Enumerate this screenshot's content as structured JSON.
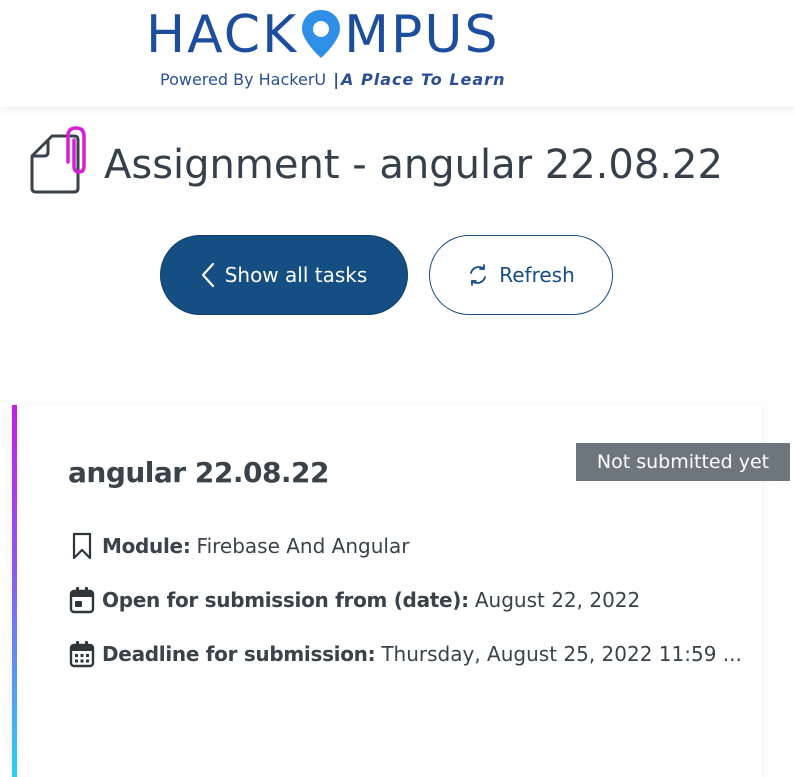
{
  "header": {
    "logo_left": "HACK",
    "logo_right": "MPUS",
    "tagline_left": "Powered By HackerU",
    "tagline_sep": "|",
    "tagline_right": "A Place To Learn",
    "brand_color": "#1d4e9e"
  },
  "page": {
    "title": "Assignment - angular 22.08.22",
    "icon": "document-paperclip-icon"
  },
  "actions": {
    "show_all_label": "Show all tasks",
    "refresh_label": "Refresh",
    "primary_color": "#154e83"
  },
  "task": {
    "title": "angular 22.08.22",
    "status": "Not submitted yet",
    "status_color": "#6d767d",
    "module_label": "Module:",
    "module_value": "Firebase And Angular",
    "open_label": "Open for submission from (date):",
    "open_value": "August 22, 2022",
    "deadline_label": "Deadline for submission:",
    "deadline_value": "Thursday, August 25, 2022 11:59 ..."
  }
}
